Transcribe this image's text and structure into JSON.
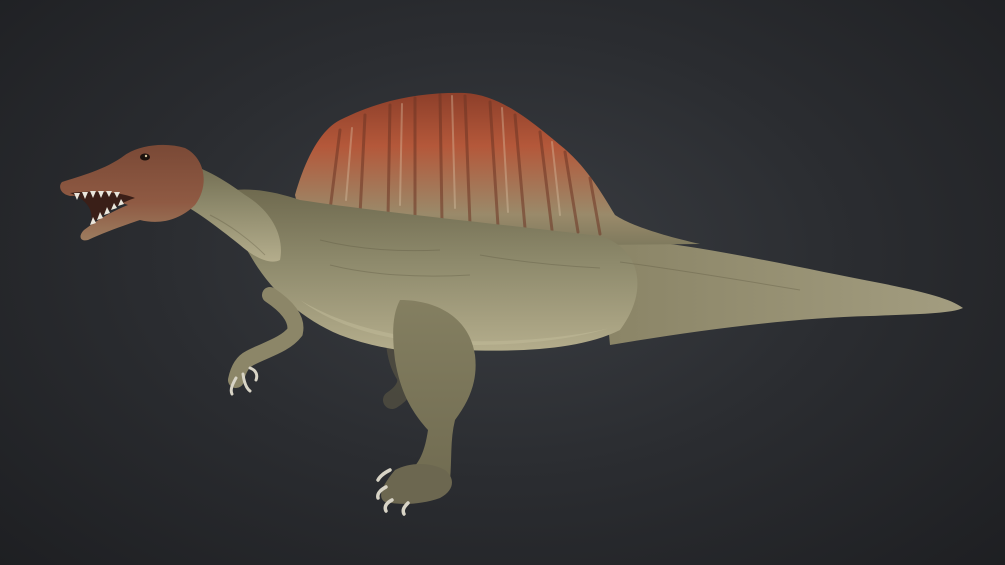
{
  "scene": {
    "subject": "spinosaurus-3d-model",
    "background_color": "#2b2d31",
    "background_highlight": "#3a3d42",
    "body_color": "#8e8a6c",
    "belly_color": "#b4ad8c",
    "sail_color": "#b4583a",
    "sail_tip_color": "#8d3f2a",
    "head_color": "#8f5a43",
    "claw_color": "#d8d4c6",
    "teeth_color": "#e9e6dc"
  }
}
